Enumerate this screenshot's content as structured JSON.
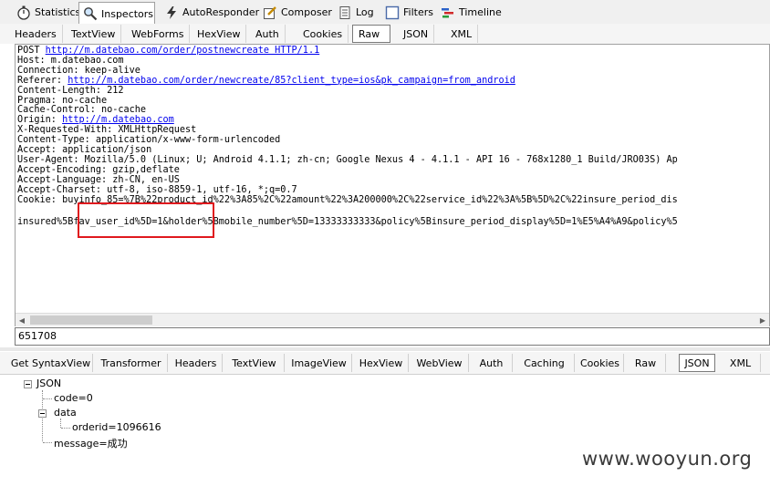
{
  "main_tabs": [
    {
      "label": "Statistics",
      "icon": "stopwatch-icon"
    },
    {
      "label": "Inspectors",
      "icon": "magnifier-icon",
      "active": true
    },
    {
      "label": "AutoResponder",
      "icon": "lightning-icon"
    },
    {
      "label": "Composer",
      "icon": "pencil-icon"
    },
    {
      "label": "Log",
      "icon": "log-icon"
    },
    {
      "label": "Filters",
      "icon": "checkbox-icon"
    },
    {
      "label": "Timeline",
      "icon": "timeline-icon"
    }
  ],
  "request_tabs": [
    "Headers",
    "TextView",
    "WebForms",
    "HexView",
    "Auth",
    "Cookies",
    "Raw",
    "JSON",
    "XML"
  ],
  "request_active_tab": "Raw",
  "raw": {
    "request_line": {
      "method": "POST ",
      "url": "http://m.datebao.com/order/postnewcreate HTTP/1.1"
    },
    "host": "Host: m.datebao.com",
    "connection": "Connection: keep-alive",
    "referer": {
      "label": "Referer: ",
      "url": "http://m.datebao.com/order/newcreate/85?client_type=ios&pk_campaign=from_android"
    },
    "content_length": "Content-Length: 212",
    "pragma": "Pragma: no-cache",
    "cache_control": "Cache-Control: no-cache",
    "origin": {
      "label": "Origin: ",
      "url": "http://m.datebao.com"
    },
    "x_requested_with": "X-Requested-With: XMLHttpRequest",
    "content_type": "Content-Type: application/x-www-form-urlencoded",
    "accept": "Accept: application/json",
    "user_agent": "User-Agent: Mozilla/5.0 (Linux; U; Android 4.1.1; zh-cn; Google Nexus 4 - 4.1.1 - API 16 - 768x1280_1 Build/JRO03S) Ap",
    "accept_encoding": "Accept-Encoding: gzip,deflate",
    "accept_language": "Accept-Language: zh-CN, en-US",
    "accept_charset": "Accept-Charset: utf-8, iso-8859-1, utf-16, *;q=0.7",
    "cookie": "Cookie: buyinfo_85=%7B%22product_id%22%3A85%2C%22amount%22%3A200000%2C%22service_id%22%3A%5B%5D%2C%22insure_period_dis",
    "body": "insured%5Bfav_user_id%5D=1&holder%5Bmobile_number%5D=13333333333&policy%5Binsure_period_display%5D=1%E5%A4%A9&policy%5"
  },
  "find_value": "651708",
  "response_tabs": [
    "Get SyntaxView",
    "Transformer",
    "Headers",
    "TextView",
    "ImageView",
    "HexView",
    "WebView",
    "Auth",
    "Caching",
    "Cookies",
    "Raw",
    "JSON",
    "XML"
  ],
  "response_active_tab": "JSON",
  "json_tree": {
    "root": "JSON",
    "code": "code=0",
    "data": "data",
    "orderid": "orderid=1096616",
    "message": "message=成功"
  },
  "watermark": "www.wooyun.org",
  "colors": {
    "highlight_box": "#e0191e",
    "link": "#0000ee"
  }
}
